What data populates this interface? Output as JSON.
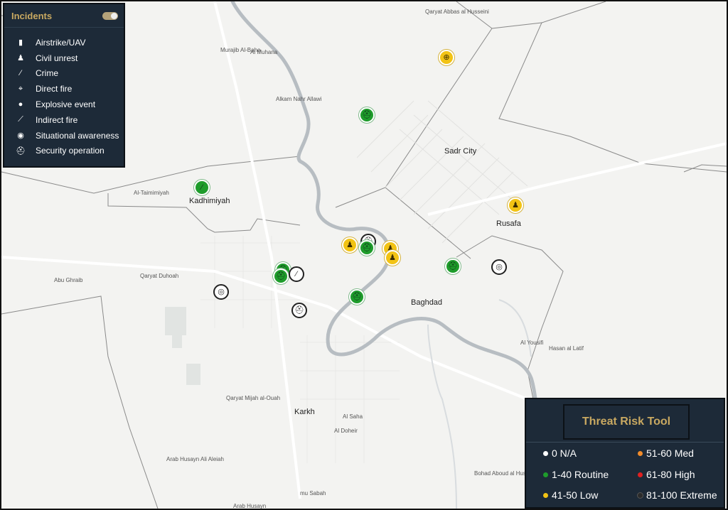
{
  "map": {
    "places": [
      {
        "id": "kadhimiyah",
        "label": "Kadhimiyah"
      },
      {
        "id": "sadr",
        "label": "Sadr City"
      },
      {
        "id": "rusafa",
        "label": "Rusafa"
      },
      {
        "id": "baghdad",
        "label": "Baghdad"
      },
      {
        "id": "karkh",
        "label": "Karkh"
      },
      {
        "id": "abughraib",
        "label": "Abu Ghraib"
      },
      {
        "id": "qaryat_duhoah",
        "label": "Qaryat Duhoah"
      },
      {
        "id": "al_tamimiyah",
        "label": "Al-Taimimiyah"
      },
      {
        "id": "murajib",
        "label": "Murajib Al-Baha"
      },
      {
        "id": "muhana",
        "label": "Al Muhana"
      },
      {
        "id": "alkam",
        "label": "Alkam Nahr Allawi"
      },
      {
        "id": "qaryat_mijah",
        "label": "Qaryat Mijah al-Ouah"
      },
      {
        "id": "alsaha",
        "label": "Al Saha"
      },
      {
        "id": "aldoheir",
        "label": "Al Doheir"
      },
      {
        "id": "arab_husayn",
        "label": "Arab Husayn Ali Aleiah"
      },
      {
        "id": "bohad",
        "label": "Bohad Aboud al Hussein"
      },
      {
        "id": "mu_sabah",
        "label": "mu Sabah"
      },
      {
        "id": "arab_husayn2",
        "label": "Arab Husayn"
      },
      {
        "id": "al_yousifi",
        "label": "Al Yousifi"
      },
      {
        "id": "hasan",
        "label": "Hasan al Latif"
      },
      {
        "id": "qaryat_abbas",
        "label": "Qaryat Abbas al Husseini"
      }
    ],
    "markers": [
      {
        "id": "m1",
        "type": "situational",
        "color": "#f2c314",
        "icon": "⊕"
      },
      {
        "id": "m2",
        "type": "security",
        "color": "#1e9c2b",
        "icon": "⛑"
      },
      {
        "id": "m3",
        "type": "crime",
        "color": "#1e9c2b",
        "icon": "⁄"
      },
      {
        "id": "m4",
        "type": "civil",
        "color": "#f2c314",
        "icon": "♟"
      },
      {
        "id": "m5",
        "type": "civil",
        "color": "#f2c314",
        "icon": "♟"
      },
      {
        "id": "m6",
        "type": "security",
        "color": "#ffffff",
        "icon": "⛑"
      },
      {
        "id": "m7",
        "type": "security",
        "color": "#1e9c2b",
        "icon": "⛑"
      },
      {
        "id": "m8",
        "type": "civil",
        "color": "#f2c314",
        "icon": "♟"
      },
      {
        "id": "m9",
        "type": "civil",
        "color": "#f2c314",
        "icon": "♟"
      },
      {
        "id": "m10",
        "type": "security",
        "color": "#1e9c2b",
        "icon": "⛑"
      },
      {
        "id": "m11",
        "type": "situational",
        "color": "#ffffff",
        "icon": "◎"
      },
      {
        "id": "m12",
        "type": "security",
        "color": "#1e9c2b",
        "icon": "⛑"
      },
      {
        "id": "m13",
        "type": "security",
        "color": "#1e9c2b",
        "icon": "⛑"
      },
      {
        "id": "m14",
        "type": "crime",
        "color": "#ffffff",
        "icon": "⁄"
      },
      {
        "id": "m15",
        "type": "situational",
        "color": "#ffffff",
        "icon": "◎"
      },
      {
        "id": "m16",
        "type": "security",
        "color": "#1e9c2b",
        "icon": "⛑"
      },
      {
        "id": "m17",
        "type": "security",
        "color": "#ffffff",
        "icon": "⛑"
      }
    ]
  },
  "incidents": {
    "title": "Incidents",
    "items": [
      {
        "label": "Airstrike/UAV",
        "icon": "airstrike-icon",
        "glyph": "▮"
      },
      {
        "label": "Civil unrest",
        "icon": "civil-unrest-icon",
        "glyph": "♟"
      },
      {
        "label": "Crime",
        "icon": "crime-icon",
        "glyph": "⁄"
      },
      {
        "label": "Direct fire",
        "icon": "direct-fire-icon",
        "glyph": "⌖"
      },
      {
        "label": "Explosive event",
        "icon": "explosive-icon",
        "glyph": "●"
      },
      {
        "label": "Indirect fire",
        "icon": "indirect-fire-icon",
        "glyph": "⟋"
      },
      {
        "label": "Situational awareness",
        "icon": "situational-icon",
        "glyph": "◉"
      },
      {
        "label": "Security operation",
        "icon": "security-icon",
        "glyph": "⛑"
      }
    ]
  },
  "threat": {
    "title": "Threat Risk Tool",
    "levels": [
      {
        "label": "0 N/A",
        "color": "#ffffff"
      },
      {
        "label": "51-60 Med",
        "color": "#f28c2a"
      },
      {
        "label": "1-40 Routine",
        "color": "#1e9c2b"
      },
      {
        "label": "61-80 High",
        "color": "#e02020"
      },
      {
        "label": "41-50 Low",
        "color": "#f2c314"
      },
      {
        "label": "81-100 Extreme",
        "color": "#2b2b2b"
      }
    ]
  }
}
